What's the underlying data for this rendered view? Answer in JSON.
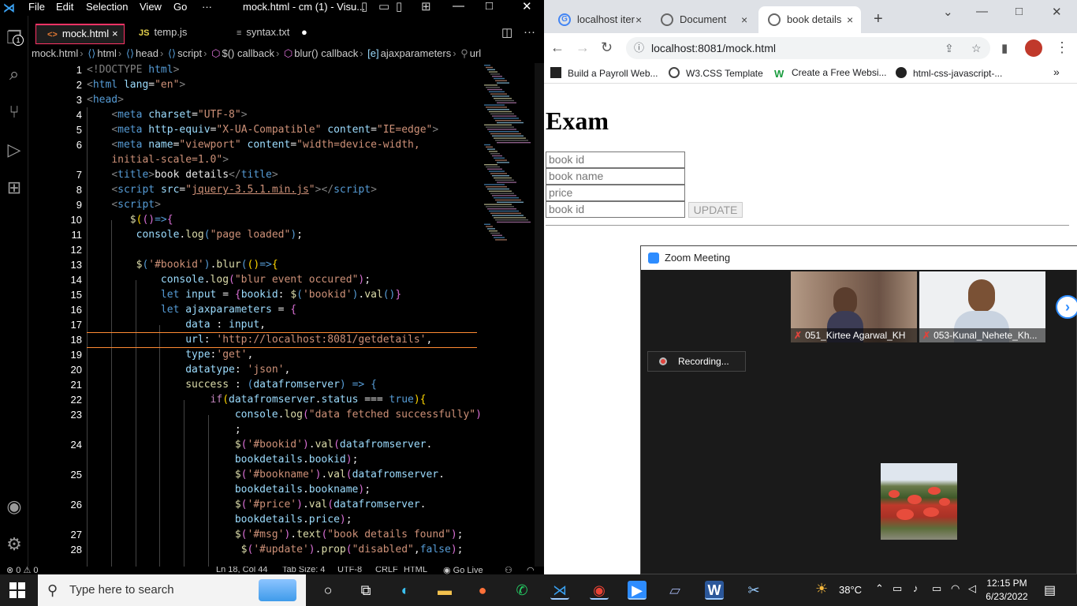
{
  "vscode": {
    "menu": [
      "File",
      "Edit",
      "Selection",
      "View",
      "Go",
      "···"
    ],
    "window_title": "mock.html - cm (1) - Visu...",
    "explorer_badge": "1",
    "tabs": [
      {
        "icon": "<>",
        "label": "mock.html",
        "close": "×"
      },
      {
        "icon": "JS",
        "label": "temp.js"
      },
      {
        "icon": "≡",
        "label": "syntax.txt",
        "close": "●"
      }
    ],
    "breadcrumb": [
      "mock.html",
      "html",
      "head",
      "script",
      "$() callback",
      "blur() callback",
      "ajaxparameters",
      "url"
    ],
    "line_numbers": [
      "1",
      "2",
      "3",
      "4",
      "5",
      "6",
      "",
      "7",
      "8",
      "9",
      "10",
      "11",
      "12",
      "13",
      "14",
      "15",
      "16",
      "17",
      "18",
      "19",
      "20",
      "21",
      "22",
      "23",
      "",
      "24",
      "",
      "25",
      "",
      "26",
      "",
      "27",
      "28"
    ],
    "status": {
      "errors": "⊗ 0 ⚠ 0",
      "position": "Ln 18, Col 44",
      "tab_size": "Tab Size: 4",
      "encoding": "UTF-8",
      "eol": "CRLF",
      "language": "HTML",
      "golive": "Go Live"
    }
  },
  "chrome": {
    "tabs": [
      {
        "label": "localhost iter",
        "close": "×"
      },
      {
        "label": "Document",
        "close": "×"
      },
      {
        "label": "book details",
        "close": "×"
      }
    ],
    "new_tab": "+",
    "url": "localhost:8081/mock.html",
    "bookmarks": [
      "Build a Payroll Web...",
      "W3.CSS Template",
      "Create a Free Websi...",
      "html-css-javascript-..."
    ],
    "page": {
      "heading": "Exam",
      "inputs": [
        "book id",
        "book name",
        "price",
        "book id"
      ],
      "button": "UPDATE"
    }
  },
  "zoom": {
    "title": "Zoom Meeting",
    "participants": [
      {
        "name": "051_Kirtee Agarwal_KH"
      },
      {
        "name": "053-Kunal_Nehete_Kh..."
      }
    ],
    "recording": "Recording..."
  },
  "taskbar": {
    "search_placeholder": "Type here to search",
    "weather": "38°C",
    "time": "12:15 PM",
    "date": "6/23/2022"
  },
  "colors": {
    "accent": "#007acc",
    "tab_border": "#ff3366",
    "zoom_blue": "#2d8cff",
    "rec_red": "#e0433c"
  }
}
